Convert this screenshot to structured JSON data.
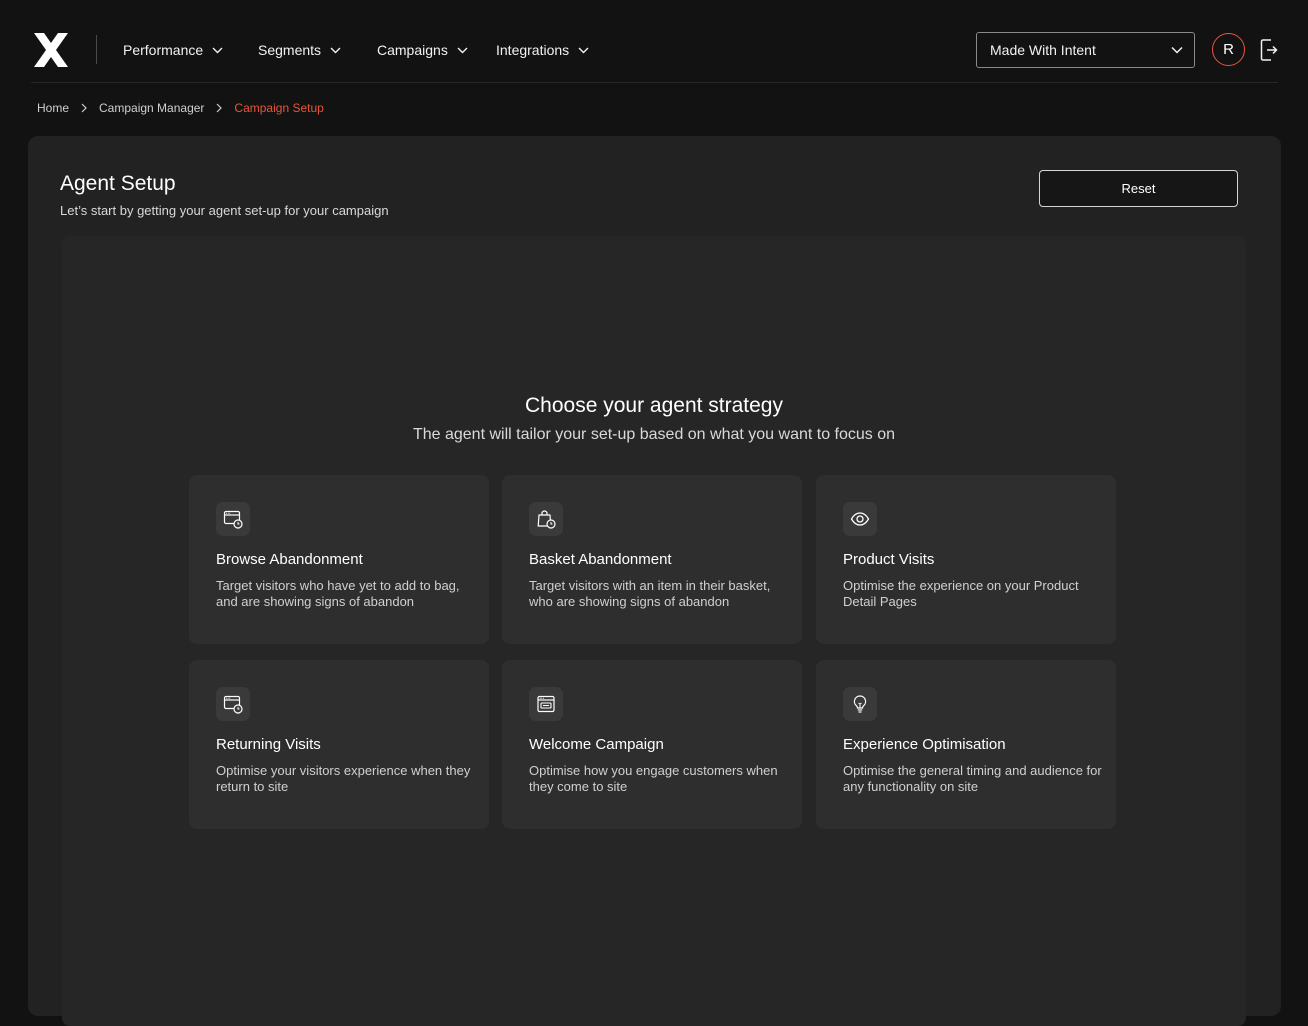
{
  "nav": {
    "items": [
      {
        "label": "Performance"
      },
      {
        "label": "Segments"
      },
      {
        "label": "Campaigns"
      },
      {
        "label": "Integrations"
      }
    ]
  },
  "account": {
    "selected": "Made With Intent"
  },
  "user": {
    "initial": "R"
  },
  "breadcrumb": [
    "Home",
    "Campaign Manager",
    "Campaign Setup"
  ],
  "page": {
    "title": "Agent Setup",
    "subtitle": "Let’s start by getting your agent set-up for your campaign",
    "reset_label": "Reset"
  },
  "strategy": {
    "title": "Choose your agent strategy",
    "subtitle": "The agent will tailor your set-up based on what you want to focus on",
    "cards": [
      {
        "icon": "browser-clock-icon",
        "title": "Browse Abandonment",
        "desc": "Target visitors who have yet to add to bag, and are showing signs of abandon"
      },
      {
        "icon": "bag-clock-icon",
        "title": "Basket Abandonment",
        "desc": "Target visitors with an item in their basket, who are showing signs of abandon"
      },
      {
        "icon": "eye-icon",
        "title": "Product Visits",
        "desc": "Optimise the experience on your Product Detail Pages"
      },
      {
        "icon": "browser-return-icon",
        "title": "Returning Visits",
        "desc": "Optimise your visitors experience when they return to site"
      },
      {
        "icon": "browser-welcome-icon",
        "title": "Welcome Campaign",
        "desc": "Optimise how you engage customers when they come to site"
      },
      {
        "icon": "lightbulb-icon",
        "title": "Experience Optimisation",
        "desc": "Optimise the general timing and audience for any functionality on site"
      }
    ]
  },
  "colors": {
    "accent": "#e8553a",
    "background": "#121212",
    "panel": "#222222",
    "card": "#2e2e2e"
  }
}
